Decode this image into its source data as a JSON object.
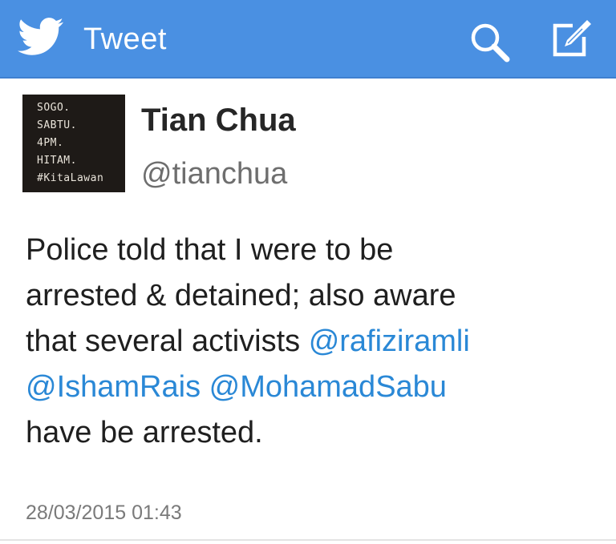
{
  "header": {
    "title": "Tweet",
    "bird_icon": "twitter-bird-icon",
    "search_icon": "search-icon",
    "compose_icon": "compose-icon",
    "background_color": "#4a90e2"
  },
  "tweet": {
    "author_name": "Tian Chua",
    "author_handle": "@tianchua",
    "avatar_text": [
      "SOGO.",
      "SABTU.",
      "4PM.",
      "HITAM.",
      "#KitaLawan"
    ],
    "line1": "Police told that I were to be",
    "line2": "arrested & detained; also aware",
    "line3_text": "that several activists ",
    "mention1": "@rafiziramli",
    "mention2": "@IshamRais",
    "line4_space": " ",
    "mention3": "@MohamadSabu",
    "line5": "have be arrested.",
    "timestamp": "28/03/2015 01:43",
    "mention_color": "#2a88d6"
  }
}
